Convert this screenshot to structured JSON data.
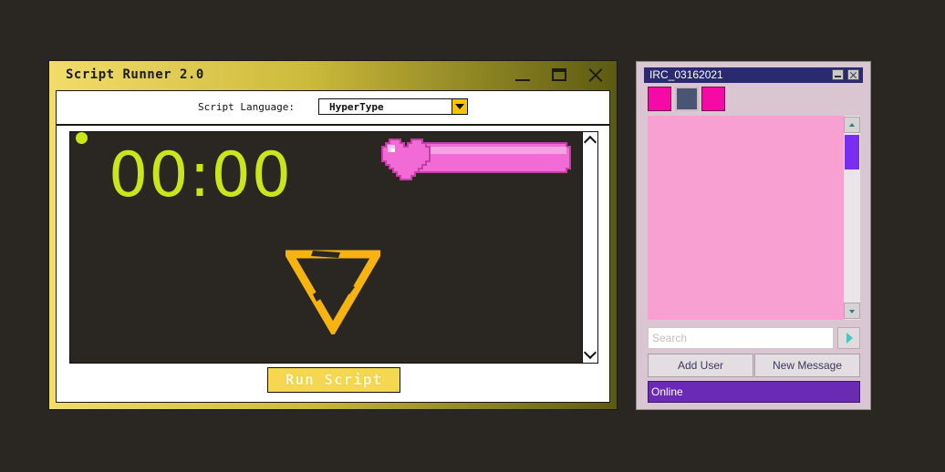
{
  "script_runner": {
    "title": "Script Runner 2.0",
    "language_label": "Script Language:",
    "language_value": "HyperType",
    "timer": "00:00",
    "run_button": "Run Script",
    "colors": {
      "timer": "#c8e619",
      "heart": "#f26ad6",
      "triangle": "#f7b410",
      "title_bar": "#e9d25a"
    }
  },
  "irc": {
    "title": "IRC_03162021",
    "swatches": [
      {
        "color": "#f50aa5"
      },
      {
        "color": "#4a5573"
      },
      {
        "color": "#f50aa5"
      }
    ],
    "search_placeholder": "Search",
    "add_user": "Add User",
    "new_message": "New Message",
    "status": "Online",
    "colors": {
      "chat_bg": "#f9a0d2",
      "status_bg": "#6a2ab4",
      "scroll_thumb": "#7a2cf0"
    }
  }
}
